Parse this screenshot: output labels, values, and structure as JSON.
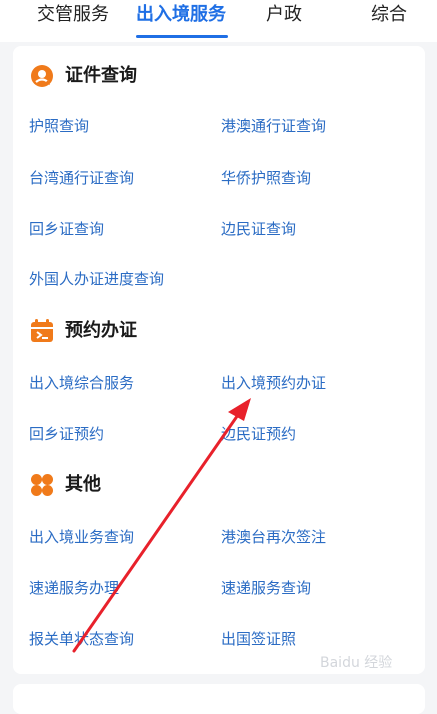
{
  "tabs": [
    {
      "label": "交管服务"
    },
    {
      "label": "出入境服务"
    },
    {
      "label": "户政"
    },
    {
      "label": "综合"
    }
  ],
  "sections": [
    {
      "title": "证件查询",
      "icon": "person-pin-icon",
      "items": [
        "护照查询",
        "港澳通行证查询",
        "台湾通行证查询",
        "华侨护照查询",
        "回乡证查询",
        "边民证查询",
        "外国人办证进度查询"
      ]
    },
    {
      "title": "预约办证",
      "icon": "calendar-icon",
      "items": [
        "出入境综合服务",
        "出入境预约办证",
        "回乡证预约",
        "边民证预约"
      ]
    },
    {
      "title": "其他",
      "icon": "four-petals-icon",
      "items": [
        "出入境业务查询",
        "港澳台再次签注",
        "速递服务办理",
        "速递服务查询",
        "报关单状态查询",
        "出国签证照"
      ]
    }
  ],
  "watermark": "Baidu 经验",
  "colors": {
    "accent_blue": "#1f6fe5",
    "link_blue": "#2b6cc4",
    "icon_orange": "#f07a1a",
    "arrow_red": "#e8212b"
  }
}
